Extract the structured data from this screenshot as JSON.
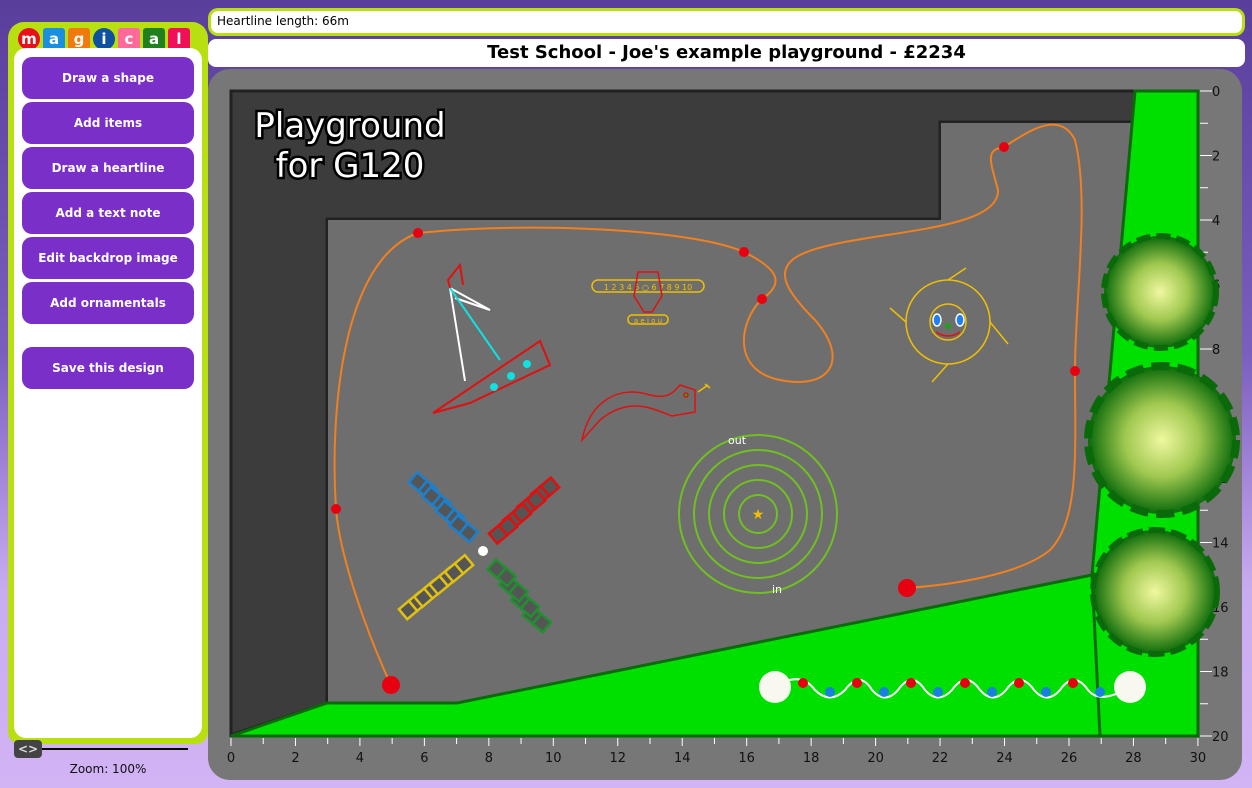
{
  "logo": {
    "letters": [
      "m",
      "a",
      "g",
      "i",
      "c",
      "a",
      "l"
    ],
    "colors": [
      "#e8101a",
      "#1a8fe0",
      "#f07a10",
      "#1050a0",
      "#ff6a9a",
      "#208020",
      "#f0105a"
    ]
  },
  "sidebar": {
    "buttons": [
      {
        "label": "Draw a shape"
      },
      {
        "label": "Add items"
      },
      {
        "label": "Draw a heartline"
      },
      {
        "label": "Add a text note"
      },
      {
        "label": "Edit backdrop image"
      },
      {
        "label": "Add ornamentals"
      },
      {
        "label": "Save this design"
      }
    ]
  },
  "zoom": {
    "label": "Zoom: 100%",
    "value_percent": 100
  },
  "status": {
    "text": "Heartline length: 66m"
  },
  "header": {
    "title": "Test School - Joe's example playground - £2234"
  },
  "canvas": {
    "note_lines": [
      "Playground",
      "for G120"
    ],
    "x_ticks": [
      0,
      2,
      4,
      6,
      8,
      10,
      12,
      14,
      16,
      18,
      20,
      22,
      24,
      26,
      28,
      30
    ],
    "y_ticks": [
      0,
      2,
      4,
      6,
      8,
      10,
      12,
      14,
      16,
      18,
      20
    ],
    "number_line": "1 2 3 4 5 ○ 6 7 8 9 10",
    "vowels": "a e i o u",
    "maze_out": "out",
    "maze_in": "in",
    "colors": {
      "grass": "#00e000",
      "tarmac": "#6e6e6e",
      "dark": "#3c3c3c",
      "heartline": "#f08020",
      "marker": "#e80010"
    }
  }
}
